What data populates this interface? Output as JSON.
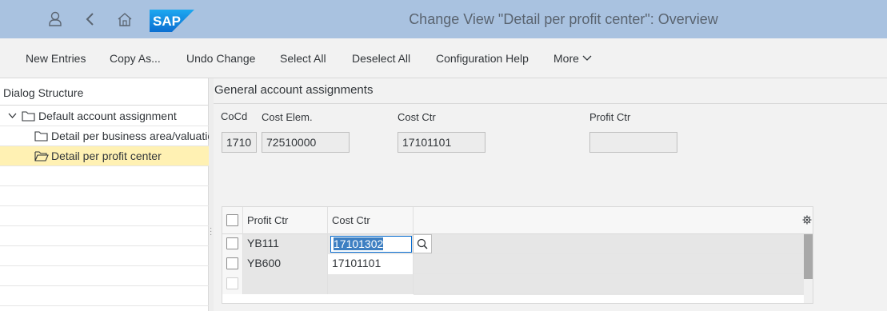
{
  "header": {
    "title": "Change View \"Detail per profit center\": Overview",
    "logo_text": "SAP",
    "icons": [
      "user-icon",
      "back-icon",
      "home-icon"
    ]
  },
  "toolbar": {
    "new_entries": "New Entries",
    "copy_as": "Copy As...",
    "undo_change": "Undo Change",
    "select_all": "Select All",
    "deselect_all": "Deselect All",
    "configuration_help": "Configuration Help",
    "more": "More"
  },
  "dialog_structure": {
    "title": "Dialog Structure",
    "items": [
      {
        "label": "Default account assignment",
        "level": 0,
        "expanded": true
      },
      {
        "label": "Detail per business area/valuation",
        "level": 1
      },
      {
        "label": "Detail per profit center",
        "level": 1,
        "selected": true
      }
    ]
  },
  "general": {
    "title": "General account assignments",
    "cocd_label": "CoCd",
    "cocd_value": "1710",
    "cost_elem_label": "Cost Elem.",
    "cost_elem_value": "72510000",
    "cost_ctr_label": "Cost Ctr",
    "cost_ctr_value": "17101101",
    "profit_ctr_label": "Profit Ctr",
    "profit_ctr_value": ""
  },
  "table": {
    "columns": [
      "Profit Ctr",
      "Cost Ctr"
    ],
    "rows": [
      {
        "profit_ctr": "YB111",
        "cost_ctr": "17101302",
        "editing": true
      },
      {
        "profit_ctr": "YB600",
        "cost_ctr": "17101101"
      }
    ]
  },
  "colors": {
    "header_bg": "#a9c2e0",
    "selected_row": "#fff1b3",
    "sap_blue": "#0a6ed1"
  }
}
